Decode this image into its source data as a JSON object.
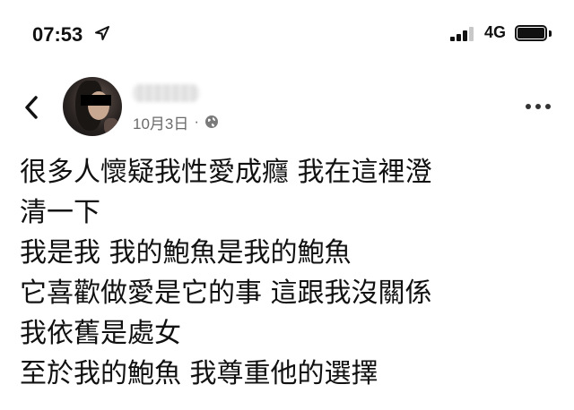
{
  "status_bar": {
    "time": "07:53",
    "network": "4G",
    "signal_bars_active": 3,
    "signal_bars_total": 4,
    "battery_level": 0.9
  },
  "post": {
    "date": "10月3日",
    "separator": "·",
    "privacy_icon": "globe-icon",
    "lines": [
      "很多人懷疑我性愛成癮 我在這裡澄",
      "清一下",
      "我是我 我的鮑魚是我的鮑魚",
      "它喜歡做愛是它的事 這跟我沒關係",
      "我依舊是處女",
      "至於我的鮑魚 我尊重他的選擇"
    ]
  },
  "colors": {
    "text": "#111111",
    "meta": "#6b6b6b",
    "background": "#ffffff"
  }
}
